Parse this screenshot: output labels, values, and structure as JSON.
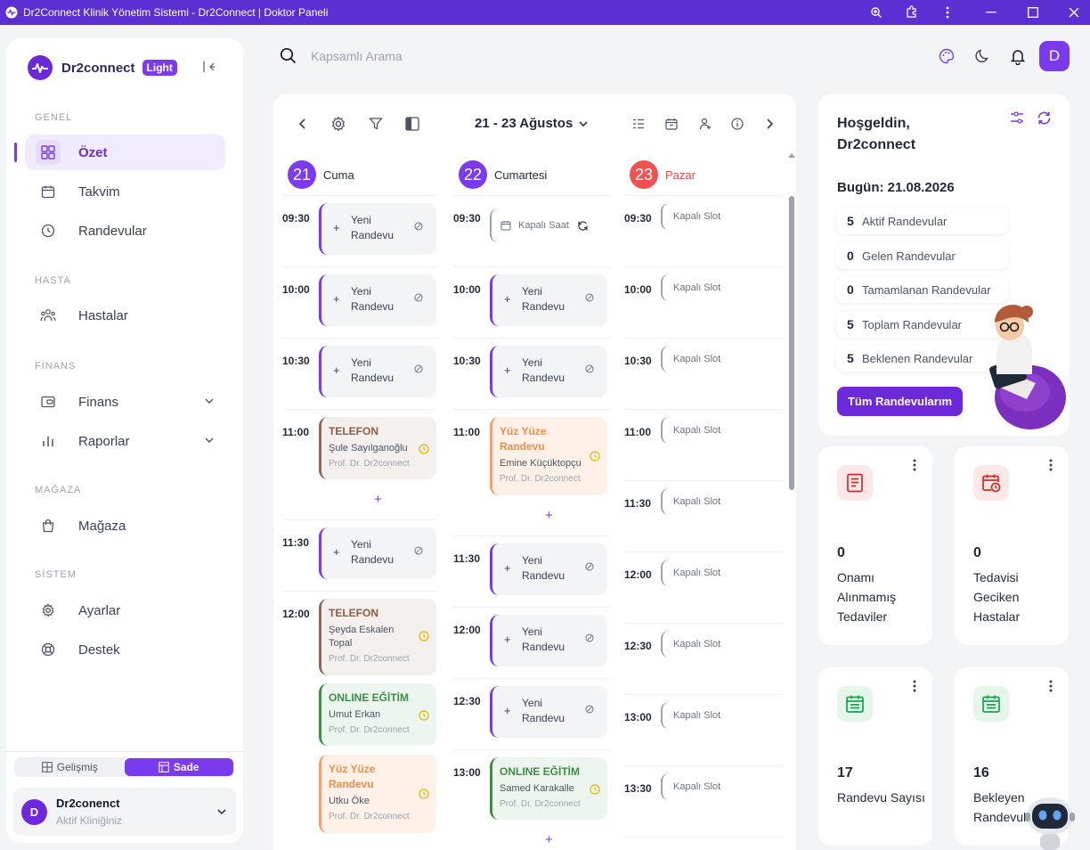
{
  "window": {
    "title": "Dr2Connect Klinik Yönetim Sistemi - Dr2Connect | Doktor Paneli"
  },
  "sidebar": {
    "brand": "Dr2connect",
    "badge": "Light",
    "sections": {
      "genel": "GENEL",
      "hasta": "HASTA",
      "finans": "FİNANS",
      "magaza": "MAĞAZA",
      "sistem": "SİSTEM"
    },
    "items": [
      {
        "label": "Özet"
      },
      {
        "label": "Takvim"
      },
      {
        "label": "Randevular"
      },
      {
        "label": "Hastalar"
      },
      {
        "label": "Finans"
      },
      {
        "label": "Raporlar"
      },
      {
        "label": "Mağaza"
      },
      {
        "label": "Ayarlar"
      },
      {
        "label": "Destek"
      }
    ],
    "mode": {
      "advanced": "Gelişmiş",
      "simple": "Sade",
      "selected": "Sade"
    },
    "clinic": {
      "avatar": "D",
      "name": "Dr2conenct",
      "subtitle": "Aktif Kliniğiniz"
    }
  },
  "header": {
    "search_placeholder": "Kapsamlı Arama",
    "avatar": "D"
  },
  "calendar": {
    "range": "21 - 23 Ağustos",
    "days": [
      {
        "num": "21",
        "name": "Cuma"
      },
      {
        "num": "22",
        "name": "Cumartesi"
      },
      {
        "num": "23",
        "name": "Pazar"
      }
    ],
    "new_label": "Yeni Randevu",
    "closed_label": "Kapalı Slot",
    "closed_hour": "Kapalı Saat",
    "day1": {
      "times": [
        "09:30",
        "10:00",
        "10:30",
        "11:00",
        "11:30",
        "12:00"
      ],
      "appts": [
        {
          "type": "TELEFON",
          "patient": "Şule Sayılganoğlu",
          "doctor": "Prof. Dr. Dr2connect"
        },
        {
          "type": "TELEFON",
          "patient": "Şeyda Eskalen Topal",
          "doctor": "Prof. Dr. Dr2connect"
        },
        {
          "type": "ONLINE EĞİTİM",
          "patient": "Umut Erkan",
          "doctor": "Prof. Dr. Dr2connect"
        },
        {
          "type": "Yüz Yüze Randevu",
          "patient": "Utku Öke",
          "doctor": "Prof. Dr. Dr2connect"
        }
      ]
    },
    "day2": {
      "times": [
        "09:30",
        "10:00",
        "10:30",
        "11:00",
        "11:30",
        "12:00",
        "12:30",
        "13:00"
      ],
      "appts": [
        {
          "type": "Yüz Yüze Randevu",
          "patient": "Emine Küçüktopçu",
          "doctor": "Prof. Dr. Dr2connect"
        },
        {
          "type": "ONLINE EĞİTİM",
          "patient": "Samed Karakalle",
          "doctor": "Prof. Dr. Dr2connect"
        }
      ]
    },
    "day3": {
      "times": [
        "09:30",
        "10:00",
        "10:30",
        "11:00",
        "11:30",
        "12:00",
        "12:30",
        "13:00",
        "13:30"
      ]
    }
  },
  "welcome": {
    "greeting": "Hoşgeldin,",
    "name": "Dr2connect",
    "today": "Bugün: 21.08.2026",
    "stats": [
      {
        "value": "5",
        "label": "Aktif Randevular"
      },
      {
        "value": "0",
        "label": "Gelen Randevular"
      },
      {
        "value": "0",
        "label": "Tamamlanan Randevular"
      },
      {
        "value": "5",
        "label": "Toplam Randevular"
      },
      {
        "value": "5",
        "label": "Beklenen Randevular"
      }
    ],
    "button": "Tüm Randevularım"
  },
  "stat_cards": [
    {
      "value": "0",
      "label": "Onamı Alınmamış Tedaviler",
      "icon": "document-icon",
      "color": "#dc2626"
    },
    {
      "value": "0",
      "label": "Tedavisi Geciken Hastalar",
      "icon": "calendar-clock-icon",
      "color": "#dc2626"
    },
    {
      "value": "17",
      "label": "Randevu Sayısı",
      "icon": "calendar-icon",
      "color": "#16a34a"
    },
    {
      "value": "16",
      "label": "Bekleyen Randevular",
      "icon": "calendar-icon",
      "color": "#16a34a"
    }
  ],
  "colors": {
    "accent": "#7c3aed",
    "titlebar": "#5b2fd1",
    "sunday": "#ef4444"
  }
}
